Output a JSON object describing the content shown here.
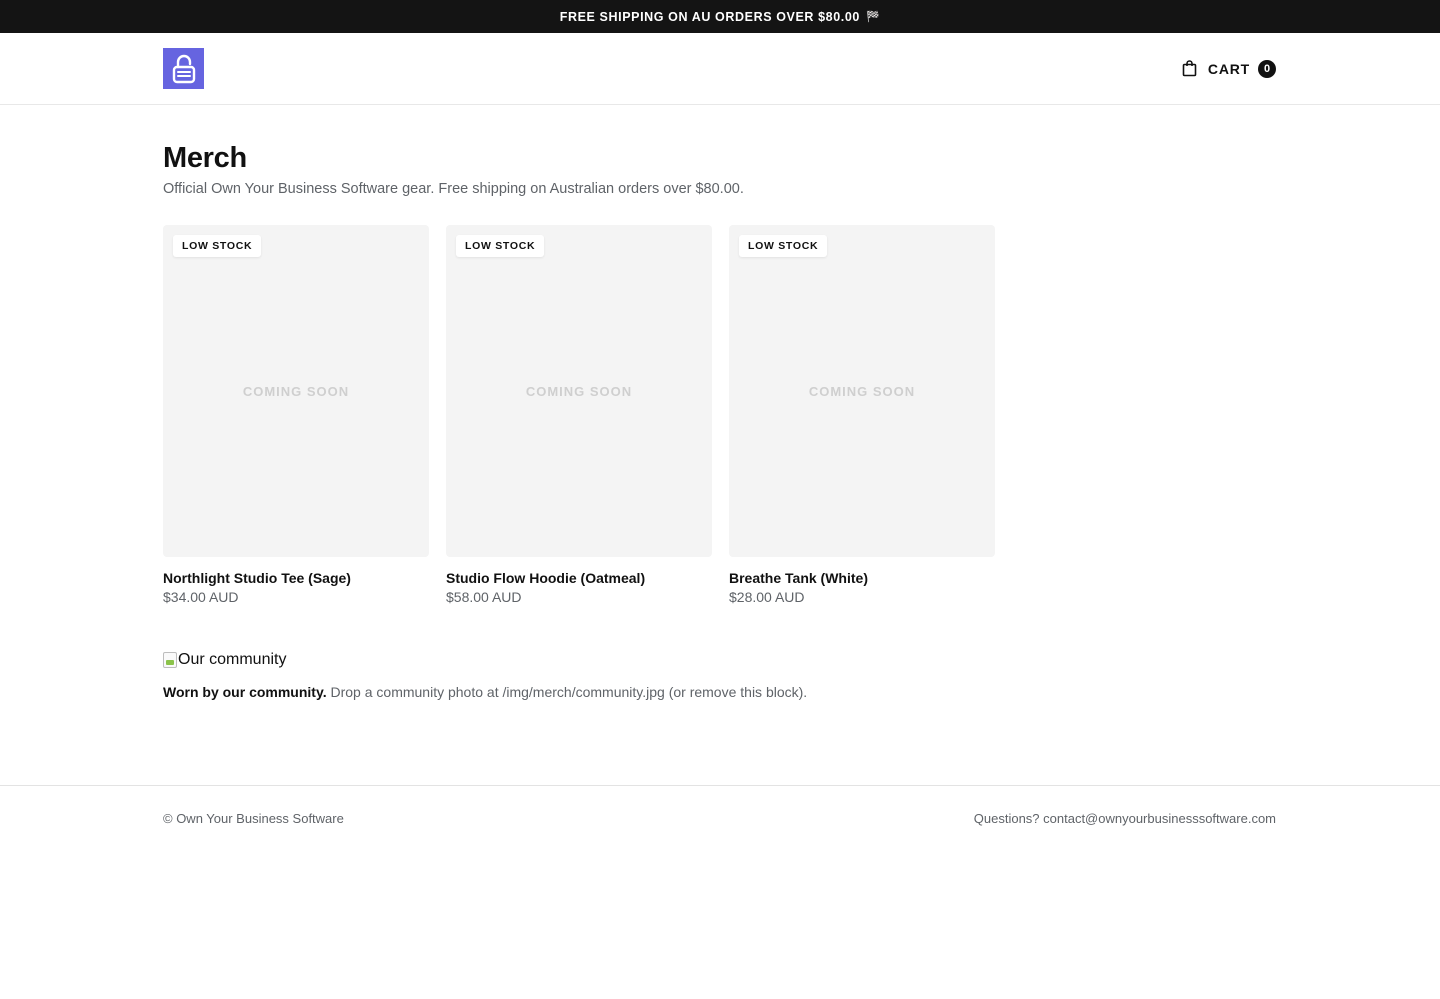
{
  "announcement": {
    "text": "FREE SHIPPING ON AU ORDERS OVER $80.00",
    "flag": "🏁"
  },
  "header": {
    "logo_icon": "lock-logo-icon",
    "accent_color": "#6664e0",
    "cart_label": "CART",
    "cart_count": "0"
  },
  "page": {
    "title": "Merch",
    "subtitle": "Official Own Your Business Software gear. Free shipping on Australian orders over $80.00."
  },
  "products": [
    {
      "badge": "LOW STOCK",
      "placeholder": "COMING SOON",
      "name": "Northlight Studio Tee (Sage)",
      "price": "$34.00 AUD"
    },
    {
      "badge": "LOW STOCK",
      "placeholder": "COMING SOON",
      "name": "Studio Flow Hoodie (Oatmeal)",
      "price": "$58.00 AUD"
    },
    {
      "badge": "LOW STOCK",
      "placeholder": "COMING SOON",
      "name": "Breathe Tank (White)",
      "price": "$28.00 AUD"
    }
  ],
  "community": {
    "image_alt": "Our community",
    "heading": "Worn by our community.",
    "text": "Drop a community photo at /img/merch/community.jpg (or remove this block)."
  },
  "footer": {
    "copyright": "© Own Your Business Software",
    "contact": "Questions? contact@ownyourbusinesssoftware.com"
  }
}
